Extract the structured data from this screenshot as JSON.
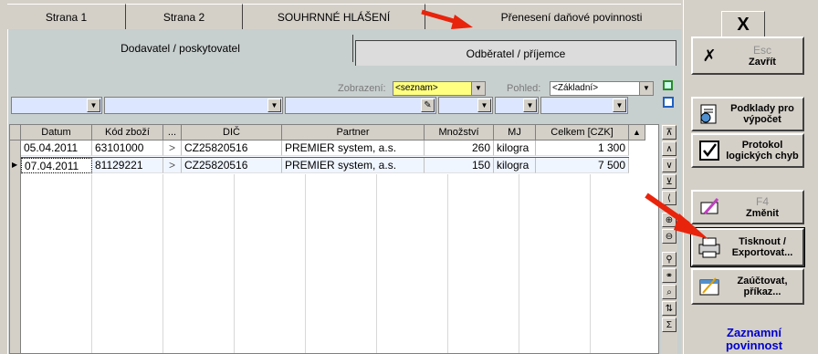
{
  "top_tabs": [
    "Strana 1",
    "Strana 2",
    "SOUHRNNÉ HLÁŠENÍ",
    "Přenesení daňové povinnosti"
  ],
  "sub_tabs": [
    "Dodavatel / poskytovatel",
    "Odběratel / příjemce"
  ],
  "view": {
    "zobrazeni_label": "Zobrazení:",
    "zobrazeni_value": "<seznam>",
    "pohled_label": "Pohled:",
    "pohled_value": "<Základní>"
  },
  "table": {
    "columns": [
      "Datum",
      "Kód zboží",
      "...",
      "DIČ",
      "Partner",
      "Množství",
      "MJ",
      "Celkem [CZK]"
    ],
    "rows": [
      {
        "datum": "05.04.2011",
        "kod": "63101000",
        "expand": ">",
        "dic": "CZ25820516",
        "partner": "PREMIER system, a.s.",
        "mnozstvi": "260",
        "mj": "kilogra",
        "celkem": "1 300"
      },
      {
        "datum": "07.04.2011",
        "kod": "81129221",
        "expand": ">",
        "dic": "CZ25820516",
        "partner": "PREMIER system, a.s.",
        "mnozstvi": "150",
        "mj": "kilogra",
        "celkem": "7 500"
      }
    ]
  },
  "right_panel": {
    "close_glyph": "X",
    "esc_label": "Esc",
    "zavrit_label": "Zavřít",
    "podklady_label": "Podklady pro výpočet",
    "protokol_label": "Protokol logických chyb",
    "f4_label": "F4",
    "zmenit_label": "Změnit",
    "tisknout_label": "Tisknout / Exportovat...",
    "zauctovat_label": "Zaúčtovat, příkaz...",
    "zaznamni_label": "Zaznamní povinnost"
  },
  "colors": {
    "window_bg": "#d4d0c8",
    "panel_bg": "#c8cfcf",
    "filter_bg": "#dde6ff",
    "highlight_yellow": "#ffff80",
    "arrow_red": "#e8240c",
    "link_blue": "#0000cc"
  }
}
